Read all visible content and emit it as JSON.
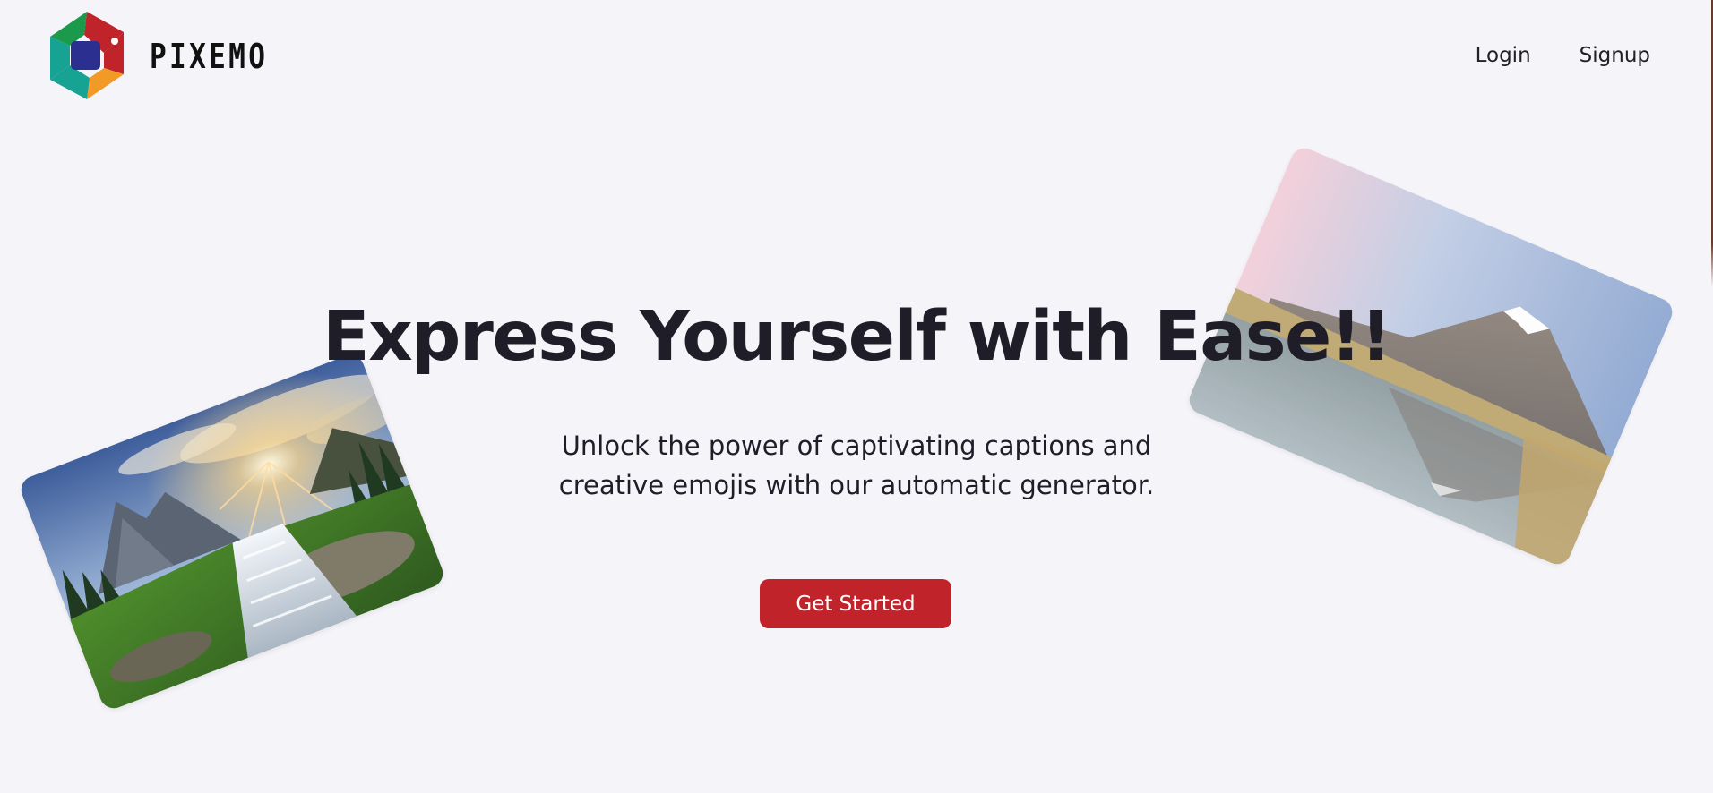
{
  "brand": {
    "name": "PIXEMO",
    "logo_icon": "pixemo-aperture-logo",
    "colors": {
      "red": "#c1232b",
      "teal": "#16a394",
      "green": "#1c9a4b",
      "orange": "#f19a27",
      "navy": "#2b2f8f"
    }
  },
  "nav": {
    "login_label": "Login",
    "signup_label": "Signup"
  },
  "hero": {
    "title": "Express Yourself with Ease!!",
    "subtitle": "Unlock the power of captivating captions and creative emojis with our automatic generator.",
    "cta_label": "Get Started",
    "cta_color": "#c1232b"
  },
  "images": {
    "left": "waterfall-landscape-photo",
    "right": "mountain-lake-reflection-photo"
  }
}
